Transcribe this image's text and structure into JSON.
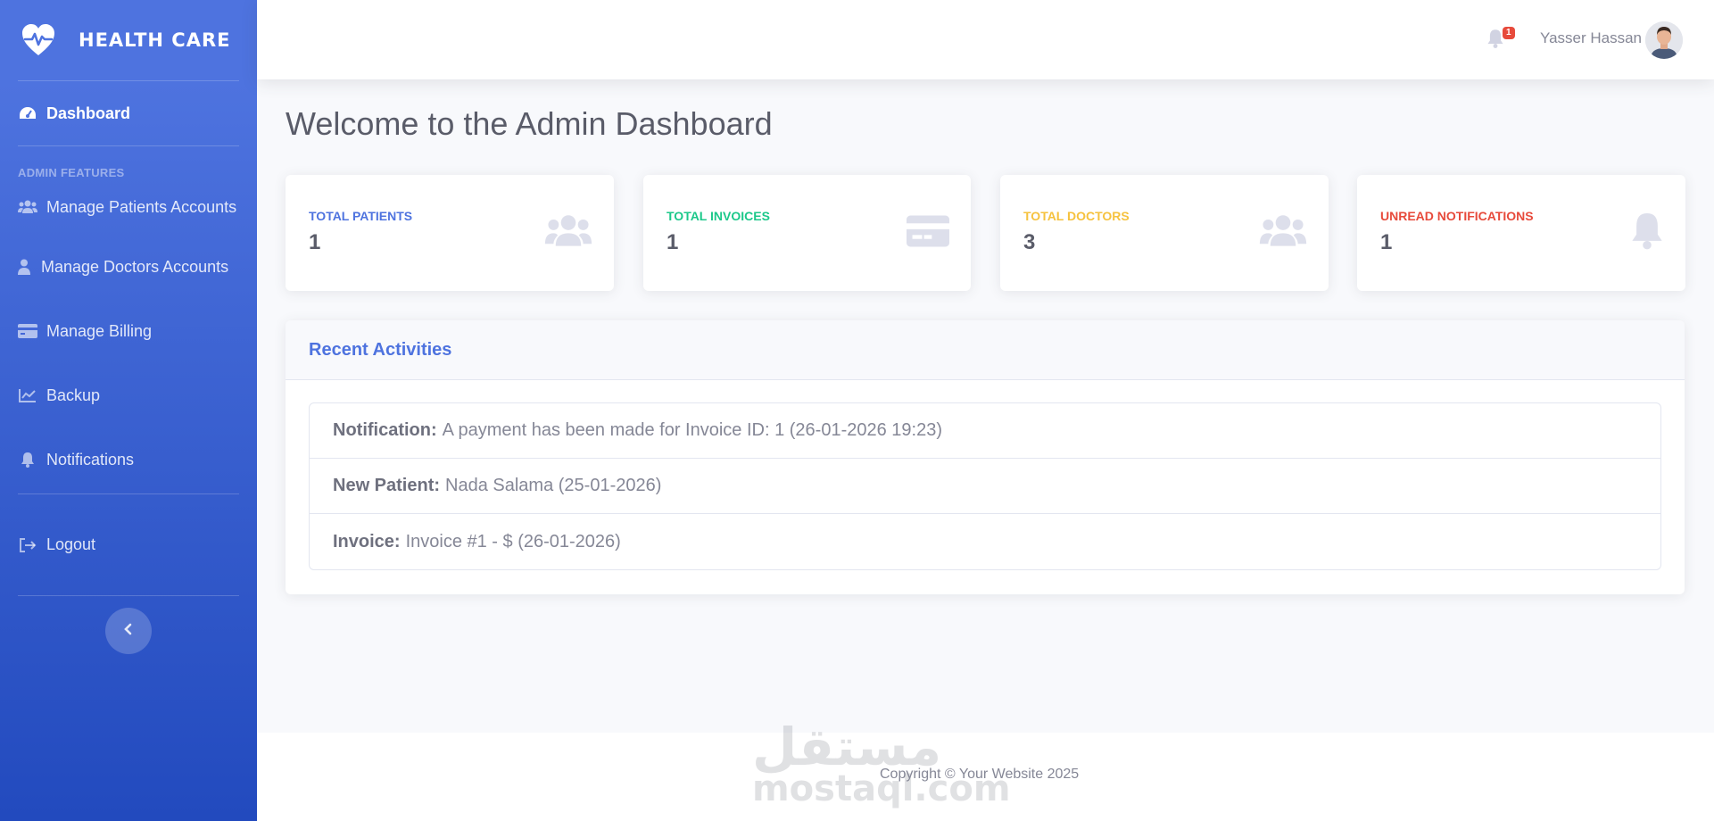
{
  "brand": {
    "name": "HEALTH CARE",
    "icon": "heart-pulse-icon"
  },
  "sidebar": {
    "dashboard": {
      "label": "Dashboard",
      "icon": "gauge-icon"
    },
    "heading": "ADMIN FEATURES",
    "items": [
      {
        "label": "Manage Patients Accounts",
        "icon": "users-icon"
      },
      {
        "label": "Manage Doctors Accounts",
        "icon": "user-doctor-icon"
      },
      {
        "label": "Manage Billing",
        "icon": "credit-card-icon"
      },
      {
        "label": "Backup",
        "icon": "chart-line-icon"
      },
      {
        "label": "Notifications",
        "icon": "bell-icon"
      }
    ],
    "logout": {
      "label": "Logout",
      "icon": "sign-out-icon"
    }
  },
  "topbar": {
    "notification_count": "1",
    "user_name": "Yasser Hassan"
  },
  "main": {
    "title": "Welcome to the Admin Dashboard",
    "cards": [
      {
        "label": "TOTAL PATIENTS",
        "value": "1",
        "color": "#4e73df",
        "icon": "users-icon"
      },
      {
        "label": "TOTAL INVOICES",
        "value": "1",
        "color": "#1cc88a",
        "icon": "credit-card-icon"
      },
      {
        "label": "TOTAL DOCTORS",
        "value": "3",
        "color": "#f6c23e",
        "icon": "users-icon"
      },
      {
        "label": "UNREAD NOTIFICATIONS",
        "value": "1",
        "color": "#e74a3b",
        "icon": "bell-icon"
      }
    ],
    "activities": {
      "title": "Recent Activities",
      "items": [
        {
          "label": "Notification:",
          "text": "A payment has been made for Invoice ID: 1 (26-01-2026 19:23)"
        },
        {
          "label": "New Patient:",
          "text": "Nada Salama (25-01-2026)"
        },
        {
          "label": "Invoice:",
          "text": "Invoice #1 - $ (26-01-2026)"
        }
      ]
    }
  },
  "footer": {
    "copyright": "Copyright © Your Website 2025",
    "watermark_ar": "مستقل",
    "watermark_en": "mostaql.com"
  }
}
